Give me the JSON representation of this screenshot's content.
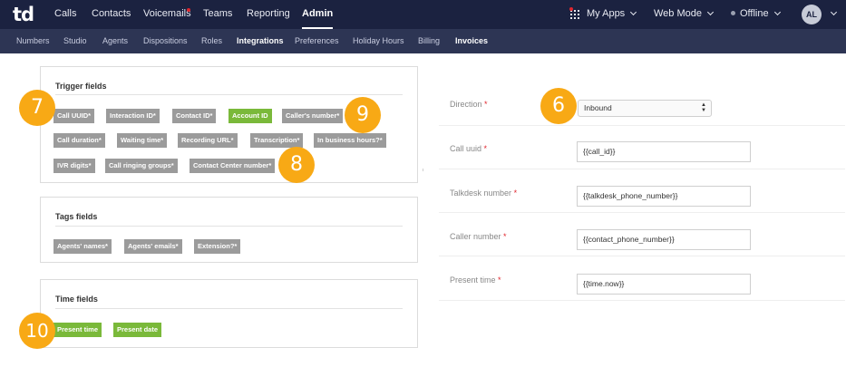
{
  "topbar": {
    "logo": "td",
    "nav": [
      "Calls",
      "Contacts",
      "Voicemails",
      "Teams",
      "Reporting",
      "Admin"
    ],
    "active_nav": "Admin",
    "my_apps": "My Apps",
    "web_mode": "Web Mode",
    "status": "Offline",
    "avatar_initials": "AL"
  },
  "subnav": [
    "Numbers",
    "Studio",
    "Agents",
    "Dispositions",
    "Roles",
    "Integrations",
    "Preferences",
    "Holiday Hours",
    "Billing",
    "Invoices"
  ],
  "trigger_fields": {
    "title": "Trigger fields",
    "chips": [
      "Call UUID*",
      "Interaction ID*",
      "Contact ID*",
      "Account ID",
      "Caller's number*",
      "Call duration*",
      "Waiting time*",
      "Recording URL*",
      "Transcription*",
      "In business hours?*",
      "IVR digits*",
      "Call ringing groups*",
      "Contact Center number*"
    ]
  },
  "tags_fields": {
    "title": "Tags fields",
    "chips": [
      "Agents' names*",
      "Agents' emails*",
      "Extension?*"
    ]
  },
  "time_fields": {
    "title": "Time fields",
    "chips": [
      "Present time",
      "Present date"
    ]
  },
  "markers": [
    "7",
    "9",
    "8",
    "6",
    "10"
  ],
  "form": {
    "direction": {
      "label": "Direction",
      "required": "*",
      "value": "Inbound"
    },
    "call_uuid": {
      "label": "Call uuid",
      "required": "*",
      "value": "{{call_id}}"
    },
    "talkdesk_number": {
      "label": "Talkdesk number",
      "required": "*",
      "value": "{{talkdesk_phone_number}}"
    },
    "caller_number": {
      "label": "Caller number",
      "required": "*",
      "value": "{{contact_phone_number}}"
    },
    "present_time": {
      "label": "Present time",
      "required": "*",
      "value": "{{time.now}}"
    }
  },
  "colors": {
    "topbar": "#1b2240",
    "subbar": "#2d3554",
    "chip_gray": "#9b9b9b",
    "chip_green": "#7ab93a",
    "marker": "#f8a915",
    "required": "#e0262e"
  }
}
